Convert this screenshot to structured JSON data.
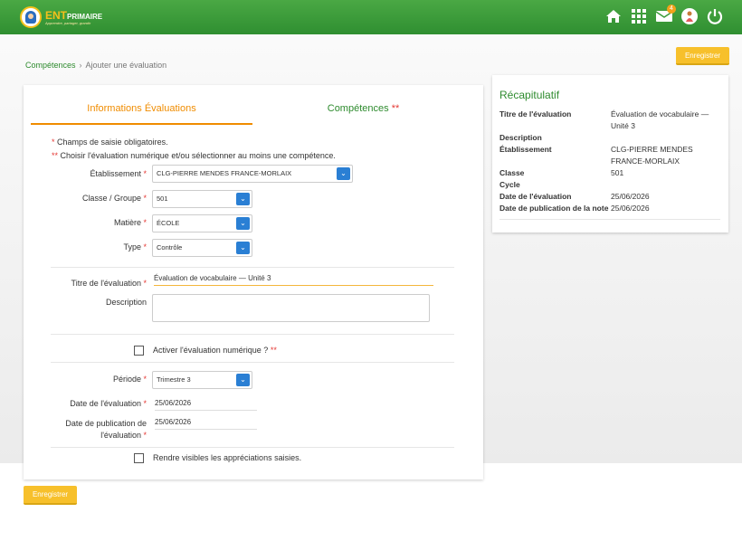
{
  "header": {
    "logo_brand": "ENT",
    "logo_brand_suffix": "PRIMAIRE",
    "logo_tagline": "Apprendre, partager, grandir",
    "mail_badge": "4",
    "icons": [
      "home-icon",
      "apps-grid-icon",
      "mail-icon",
      "user-avatar-icon",
      "power-icon"
    ]
  },
  "breadcrumb": {
    "parent": "Compétences",
    "separator": "›",
    "current": "Ajouter une évaluation"
  },
  "actions": {
    "save_top": "Enregistrer",
    "save_bottom": "Enregistrer"
  },
  "tabs": [
    {
      "label": "Informations Évaluations",
      "active": true,
      "required": ""
    },
    {
      "label": "Compétences",
      "active": false,
      "required": "**"
    }
  ],
  "notes": {
    "required_fields_star": "*",
    "required_fields": "Champs de saisie obligatoires.",
    "choose_star": "**",
    "choose": "Choisir l'évaluation numérique et/ou sélectionner au moins une compétence."
  },
  "form": {
    "etablissement": {
      "label": "Établissement",
      "req": "*",
      "value": "CLG-PIERRE MENDES FRANCE-MORLAIX"
    },
    "classe": {
      "label": "Classe / Groupe",
      "req": "*",
      "value": "501"
    },
    "matiere": {
      "label": "Matière",
      "req": "*",
      "value": "ÉCOLE"
    },
    "type": {
      "label": "Type",
      "req": "*",
      "value": "Contrôle"
    },
    "titre": {
      "label": "Titre de l'évaluation",
      "req": "*",
      "value": "Évaluation de vocabulaire — Unité 3"
    },
    "description": {
      "label": "Description",
      "value": ""
    },
    "numerique": {
      "label": "Activer l'évaluation numérique ?",
      "req": "**",
      "checked": false
    },
    "periode": {
      "label": "Période",
      "req": "*",
      "value": "Trimestre 3"
    },
    "date_eval": {
      "label": "Date de l'évaluation",
      "req": "*",
      "value": "25/06/2026"
    },
    "date_pub": {
      "label_line1": "Date de publication de",
      "label_line2": "l'évaluation",
      "req": "*",
      "value": "25/06/2026"
    },
    "visibles": {
      "label": "Rendre visibles les appréciations saisies.",
      "checked": false
    }
  },
  "recap": {
    "title": "Récapitulatif",
    "rows": [
      {
        "key": "Titre de l'évaluation",
        "value": "Évaluation de vocabulaire — Unité 3"
      },
      {
        "key": "Description",
        "value": ""
      },
      {
        "key": "Établissement",
        "value": "CLG-PIERRE MENDES FRANCE-MORLAIX"
      },
      {
        "key": "Classe",
        "value": "501"
      },
      {
        "key": "Cycle",
        "value": ""
      },
      {
        "key": "Date de l'évaluation",
        "value": "25/06/2026"
      },
      {
        "key": "Date de publication de la note",
        "value": "25/06/2026"
      }
    ]
  },
  "colors": {
    "header_green": "#3a9b3a",
    "accent_orange": "#f08c00",
    "link_green": "#2e8b2e",
    "button_yellow": "#f7c02b",
    "select_blue": "#2a7fd4",
    "required_red": "#e53935"
  }
}
